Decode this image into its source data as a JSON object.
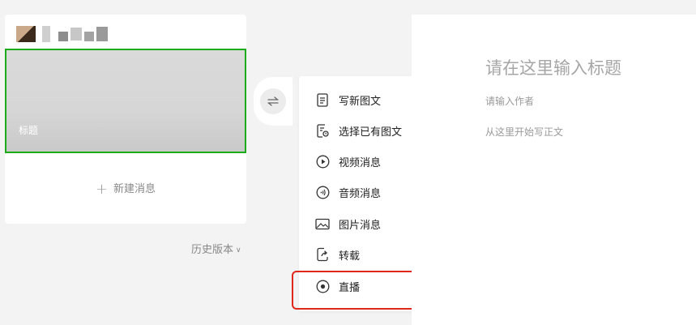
{
  "article_list": {
    "cover_title": "标题",
    "new_message_label": "新建消息",
    "history_label": "历史版本"
  },
  "menu": {
    "items": [
      {
        "label": "写新图文",
        "icon": "document-icon"
      },
      {
        "label": "选择已有图文",
        "icon": "document-search-icon"
      },
      {
        "label": "视频消息",
        "icon": "play-circle-icon"
      },
      {
        "label": "音频消息",
        "icon": "audio-wave-icon"
      },
      {
        "label": "图片消息",
        "icon": "image-icon"
      },
      {
        "label": "转载",
        "icon": "share-icon"
      },
      {
        "label": "直播",
        "icon": "live-icon"
      }
    ],
    "highlighted_item": "直播"
  },
  "editor": {
    "title_placeholder": "请在这里输入标题",
    "author_placeholder": "请输入作者",
    "body_placeholder": "从这里开始写正文"
  },
  "colors": {
    "selection_border": "#1aad19",
    "highlight_border": "#e0271c"
  }
}
